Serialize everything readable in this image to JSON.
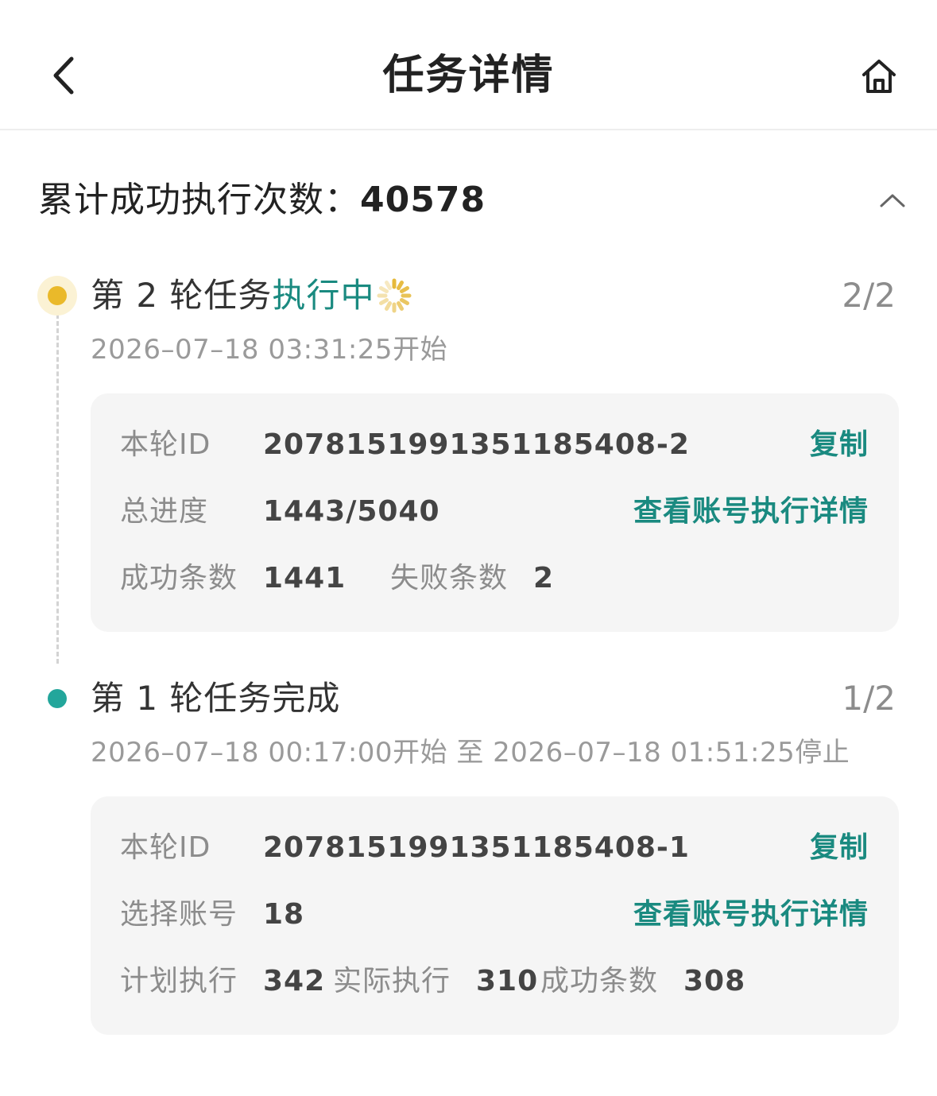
{
  "header": {
    "title": "任务详情",
    "back_icon": "chevron-left-icon",
    "home_icon": "home-icon"
  },
  "summary": {
    "label": "累计成功执行次数：",
    "value": "40578",
    "toggle_icon": "chevron-up-icon"
  },
  "colors": {
    "accent": "#1a8a80",
    "running_dot": "#eab92a",
    "done_dot": "#23a69b"
  },
  "rounds": [
    {
      "title_prefix": "第 2 轮任务",
      "status": "执行中",
      "count": "2/2",
      "time": "2026–07–18 03:31:25开始",
      "details": {
        "id_label": "本轮ID",
        "id_value": "2078151991351185408-2",
        "copy_label": "复制",
        "progress_label": "总进度",
        "progress_value": "1443/5040",
        "view_label": "查看账号执行详情",
        "success_label": "成功条数",
        "success_value": "1441",
        "fail_label": "失败条数",
        "fail_value": "2"
      }
    },
    {
      "title": "第 1 轮任务完成",
      "count": "1/2",
      "time": "2026–07–18 00:17:00开始 至 2026–07–18 01:51:25停止",
      "details": {
        "id_label": "本轮ID",
        "id_value": "2078151991351185408-1",
        "copy_label": "复制",
        "accounts_label": "选择账号",
        "accounts_value": "18",
        "view_label": "查看账号执行详情",
        "planned_label": "计划执行",
        "planned_value": "342",
        "actual_label": "实际执行",
        "actual_value": "310",
        "success_label": "成功条数",
        "success_value": "308"
      }
    }
  ]
}
